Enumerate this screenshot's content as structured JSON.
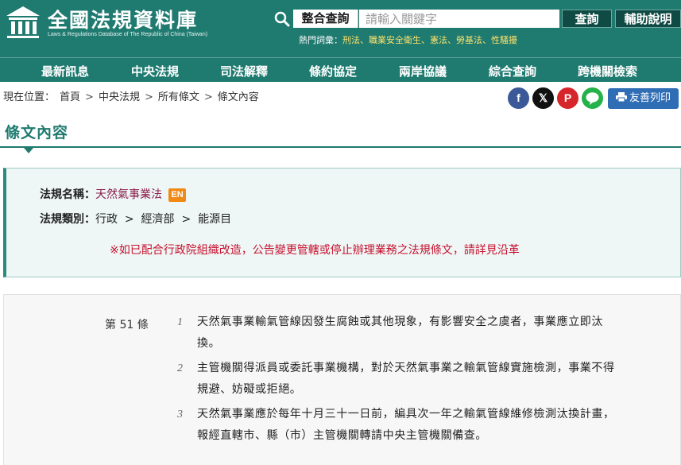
{
  "site": {
    "title": "全國法規資料庫",
    "subtitle": "Laws & Regulations Database of The Republic of China (Taiwan)"
  },
  "search": {
    "type_label": "整合查詢",
    "placeholder": "請輸入關鍵字",
    "query_button": "查詢",
    "help_button": "輔助說明"
  },
  "hot_terms": {
    "label": "熱門詞彙：",
    "items": [
      "刑法",
      "職業安全衛生",
      "憲法",
      "勞基法",
      "性騷擾"
    ]
  },
  "nav": {
    "items": [
      "最新訊息",
      "中央法規",
      "司法解釋",
      "條約協定",
      "兩岸協議",
      "綜合查詢",
      "跨機關檢索"
    ]
  },
  "breadcrumb": {
    "label": "現在位置：",
    "items": [
      "首頁",
      "中央法規",
      "所有條文",
      "條文內容"
    ],
    "separator": ">"
  },
  "share": {
    "facebook": "f",
    "x": "𝕏",
    "pinterest": "P",
    "line": "LINE",
    "print_label": "友善列印"
  },
  "section_title": "條文內容",
  "law": {
    "name_label": "法規名稱：",
    "name": "天然氣事業法",
    "en_badge": "EN",
    "category_label": "法規類別：",
    "category": [
      "行政",
      "經濟部",
      "能源目"
    ],
    "category_separator": ">",
    "notice": "※如已配合行政院組織改造，公告變更管轄或停止辦理業務之法規條文，請詳見沿革"
  },
  "article": {
    "number": "第 51 條",
    "paragraphs": [
      {
        "no": "1",
        "text": "天然氣事業輸氣管線因發生腐蝕或其他現象，有影響安全之虞者，事業應立即汰換。"
      },
      {
        "no": "2",
        "text": "主管機關得派員或委託事業機構，對於天然氣事業之輸氣管線實施檢測，事業不得規避、妨礙或拒絕。"
      },
      {
        "no": "3",
        "text": "天然氣事業應於每年十月三十一日前，編具次一年之輸氣管線維修檢測汰換計畫，報經直轄市、縣（市）主管機關轉請中央主管機關備查。"
      }
    ]
  },
  "colors": {
    "header_bg": "#1f7a70",
    "button_dark": "#0f4b44",
    "hot_link": "#ffe36b",
    "law_name": "#8a1c4a",
    "notice": "#c8102e",
    "en_badge": "#f08a16",
    "print_button": "#2f6db5"
  }
}
